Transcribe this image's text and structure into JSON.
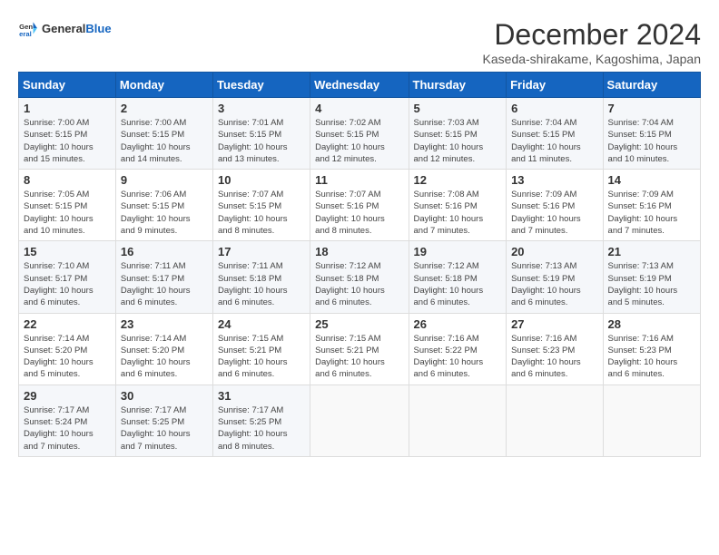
{
  "logo": {
    "general": "General",
    "blue": "Blue"
  },
  "title": "December 2024",
  "subtitle": "Kaseda-shirakame, Kagoshima, Japan",
  "days_header": [
    "Sunday",
    "Monday",
    "Tuesday",
    "Wednesday",
    "Thursday",
    "Friday",
    "Saturday"
  ],
  "weeks": [
    [
      {
        "day": "1",
        "info": "Sunrise: 7:00 AM\nSunset: 5:15 PM\nDaylight: 10 hours\nand 15 minutes."
      },
      {
        "day": "2",
        "info": "Sunrise: 7:00 AM\nSunset: 5:15 PM\nDaylight: 10 hours\nand 14 minutes."
      },
      {
        "day": "3",
        "info": "Sunrise: 7:01 AM\nSunset: 5:15 PM\nDaylight: 10 hours\nand 13 minutes."
      },
      {
        "day": "4",
        "info": "Sunrise: 7:02 AM\nSunset: 5:15 PM\nDaylight: 10 hours\nand 12 minutes."
      },
      {
        "day": "5",
        "info": "Sunrise: 7:03 AM\nSunset: 5:15 PM\nDaylight: 10 hours\nand 12 minutes."
      },
      {
        "day": "6",
        "info": "Sunrise: 7:04 AM\nSunset: 5:15 PM\nDaylight: 10 hours\nand 11 minutes."
      },
      {
        "day": "7",
        "info": "Sunrise: 7:04 AM\nSunset: 5:15 PM\nDaylight: 10 hours\nand 10 minutes."
      }
    ],
    [
      {
        "day": "8",
        "info": "Sunrise: 7:05 AM\nSunset: 5:15 PM\nDaylight: 10 hours\nand 10 minutes."
      },
      {
        "day": "9",
        "info": "Sunrise: 7:06 AM\nSunset: 5:15 PM\nDaylight: 10 hours\nand 9 minutes."
      },
      {
        "day": "10",
        "info": "Sunrise: 7:07 AM\nSunset: 5:15 PM\nDaylight: 10 hours\nand 8 minutes."
      },
      {
        "day": "11",
        "info": "Sunrise: 7:07 AM\nSunset: 5:16 PM\nDaylight: 10 hours\nand 8 minutes."
      },
      {
        "day": "12",
        "info": "Sunrise: 7:08 AM\nSunset: 5:16 PM\nDaylight: 10 hours\nand 7 minutes."
      },
      {
        "day": "13",
        "info": "Sunrise: 7:09 AM\nSunset: 5:16 PM\nDaylight: 10 hours\nand 7 minutes."
      },
      {
        "day": "14",
        "info": "Sunrise: 7:09 AM\nSunset: 5:16 PM\nDaylight: 10 hours\nand 7 minutes."
      }
    ],
    [
      {
        "day": "15",
        "info": "Sunrise: 7:10 AM\nSunset: 5:17 PM\nDaylight: 10 hours\nand 6 minutes."
      },
      {
        "day": "16",
        "info": "Sunrise: 7:11 AM\nSunset: 5:17 PM\nDaylight: 10 hours\nand 6 minutes."
      },
      {
        "day": "17",
        "info": "Sunrise: 7:11 AM\nSunset: 5:18 PM\nDaylight: 10 hours\nand 6 minutes."
      },
      {
        "day": "18",
        "info": "Sunrise: 7:12 AM\nSunset: 5:18 PM\nDaylight: 10 hours\nand 6 minutes."
      },
      {
        "day": "19",
        "info": "Sunrise: 7:12 AM\nSunset: 5:18 PM\nDaylight: 10 hours\nand 6 minutes."
      },
      {
        "day": "20",
        "info": "Sunrise: 7:13 AM\nSunset: 5:19 PM\nDaylight: 10 hours\nand 6 minutes."
      },
      {
        "day": "21",
        "info": "Sunrise: 7:13 AM\nSunset: 5:19 PM\nDaylight: 10 hours\nand 5 minutes."
      }
    ],
    [
      {
        "day": "22",
        "info": "Sunrise: 7:14 AM\nSunset: 5:20 PM\nDaylight: 10 hours\nand 5 minutes."
      },
      {
        "day": "23",
        "info": "Sunrise: 7:14 AM\nSunset: 5:20 PM\nDaylight: 10 hours\nand 6 minutes."
      },
      {
        "day": "24",
        "info": "Sunrise: 7:15 AM\nSunset: 5:21 PM\nDaylight: 10 hours\nand 6 minutes."
      },
      {
        "day": "25",
        "info": "Sunrise: 7:15 AM\nSunset: 5:21 PM\nDaylight: 10 hours\nand 6 minutes."
      },
      {
        "day": "26",
        "info": "Sunrise: 7:16 AM\nSunset: 5:22 PM\nDaylight: 10 hours\nand 6 minutes."
      },
      {
        "day": "27",
        "info": "Sunrise: 7:16 AM\nSunset: 5:23 PM\nDaylight: 10 hours\nand 6 minutes."
      },
      {
        "day": "28",
        "info": "Sunrise: 7:16 AM\nSunset: 5:23 PM\nDaylight: 10 hours\nand 6 minutes."
      }
    ],
    [
      {
        "day": "29",
        "info": "Sunrise: 7:17 AM\nSunset: 5:24 PM\nDaylight: 10 hours\nand 7 minutes."
      },
      {
        "day": "30",
        "info": "Sunrise: 7:17 AM\nSunset: 5:25 PM\nDaylight: 10 hours\nand 7 minutes."
      },
      {
        "day": "31",
        "info": "Sunrise: 7:17 AM\nSunset: 5:25 PM\nDaylight: 10 hours\nand 8 minutes."
      },
      {
        "day": "",
        "info": ""
      },
      {
        "day": "",
        "info": ""
      },
      {
        "day": "",
        "info": ""
      },
      {
        "day": "",
        "info": ""
      }
    ]
  ]
}
